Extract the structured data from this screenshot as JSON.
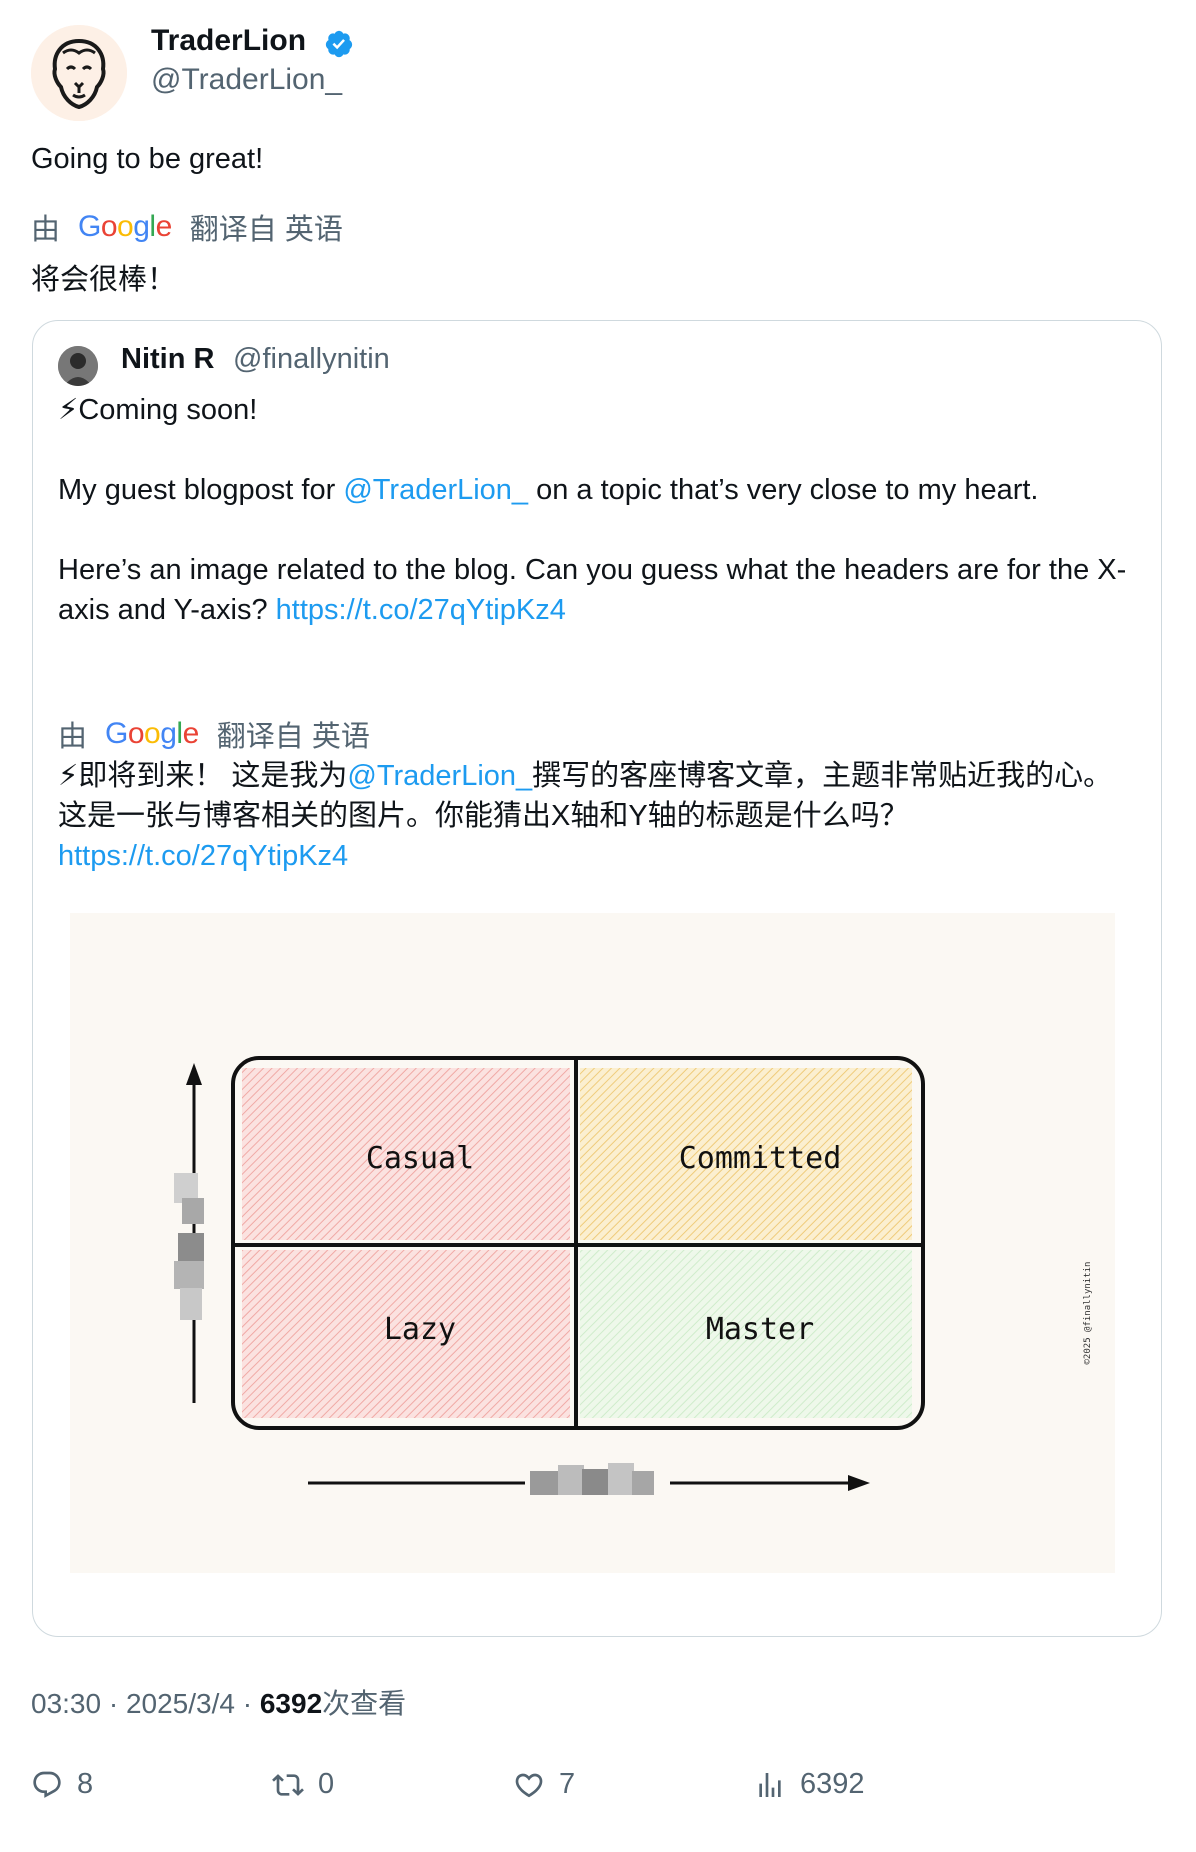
{
  "author": {
    "name": "TraderLion",
    "handle": "@TraderLion_",
    "verified": true
  },
  "tweet": {
    "text": "Going to be great!",
    "translation_prefix": "由",
    "translation_google": "Google",
    "translation_suffix": "翻译自 英语",
    "translated_text": "将会很棒！"
  },
  "quote": {
    "author_name": "Nitin R",
    "author_handle": "@finallynitin",
    "line1": "⚡Coming soon!",
    "line2_pre": "My guest blogpost for ",
    "line2_mention": "@TraderLion_",
    "line2_post": " on a topic that’s very close to my heart.",
    "line3_pre": "Here’s an image related to the blog. Can you guess what the headers are for the X-axis and Y-axis? ",
    "line3_link": "https://t.co/27qYtipKz4",
    "translation_prefix": "由",
    "translation_google": "Google",
    "translation_suffix": "翻译自 英语",
    "translated_pre": "⚡即将到来！ 这是我为",
    "translated_mention": "@TraderLion_",
    "translated_post": "撰写的客座博客文章，主题非常贴近我的心。 这是一张与博客相关的图片。你能猜出X轴和Y轴的标题是什么吗？",
    "translated_link": "https://t.co/27qYtipKz4",
    "image": {
      "quadrants": [
        "Casual",
        "Committed",
        "Lazy",
        "Master"
      ],
      "credit": "©2025 @finallynitin"
    }
  },
  "meta": {
    "time": "03:30",
    "sep1": " · ",
    "date": "2025/3/4",
    "sep2": " · ",
    "views": "6392",
    "views_label": "次查看"
  },
  "actions": {
    "replies": "8",
    "retweets": "0",
    "likes": "7",
    "views": "6392"
  },
  "colors": {
    "link": "#1d9bf0",
    "muted": "#536471",
    "casual": "#f2b8b5",
    "committed": "#f2d08a",
    "lazy": "#f2b8b5",
    "master": "#cfeecf"
  }
}
